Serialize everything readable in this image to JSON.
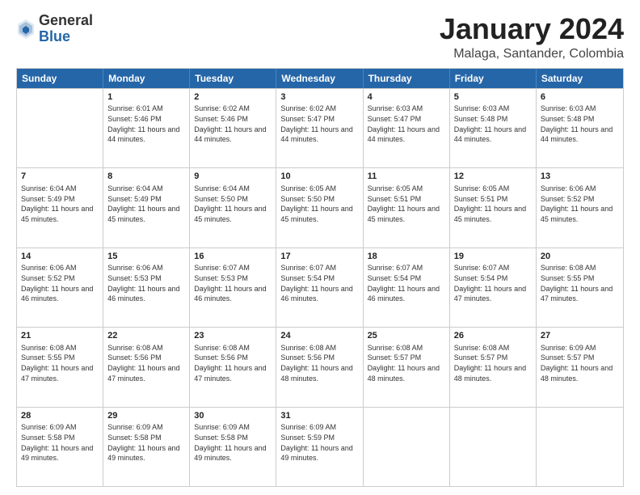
{
  "header": {
    "logo": {
      "general": "General",
      "blue": "Blue"
    },
    "title": "January 2024",
    "subtitle": "Malaga, Santander, Colombia"
  },
  "calendar": {
    "days_of_week": [
      "Sunday",
      "Monday",
      "Tuesday",
      "Wednesday",
      "Thursday",
      "Friday",
      "Saturday"
    ],
    "rows": [
      [
        {
          "day": "",
          "sunrise": "",
          "sunset": "",
          "daylight": ""
        },
        {
          "day": "1",
          "sunrise": "Sunrise: 6:01 AM",
          "sunset": "Sunset: 5:46 PM",
          "daylight": "Daylight: 11 hours and 44 minutes."
        },
        {
          "day": "2",
          "sunrise": "Sunrise: 6:02 AM",
          "sunset": "Sunset: 5:46 PM",
          "daylight": "Daylight: 11 hours and 44 minutes."
        },
        {
          "day": "3",
          "sunrise": "Sunrise: 6:02 AM",
          "sunset": "Sunset: 5:47 PM",
          "daylight": "Daylight: 11 hours and 44 minutes."
        },
        {
          "day": "4",
          "sunrise": "Sunrise: 6:03 AM",
          "sunset": "Sunset: 5:47 PM",
          "daylight": "Daylight: 11 hours and 44 minutes."
        },
        {
          "day": "5",
          "sunrise": "Sunrise: 6:03 AM",
          "sunset": "Sunset: 5:48 PM",
          "daylight": "Daylight: 11 hours and 44 minutes."
        },
        {
          "day": "6",
          "sunrise": "Sunrise: 6:03 AM",
          "sunset": "Sunset: 5:48 PM",
          "daylight": "Daylight: 11 hours and 44 minutes."
        }
      ],
      [
        {
          "day": "7",
          "sunrise": "Sunrise: 6:04 AM",
          "sunset": "Sunset: 5:49 PM",
          "daylight": "Daylight: 11 hours and 45 minutes."
        },
        {
          "day": "8",
          "sunrise": "Sunrise: 6:04 AM",
          "sunset": "Sunset: 5:49 PM",
          "daylight": "Daylight: 11 hours and 45 minutes."
        },
        {
          "day": "9",
          "sunrise": "Sunrise: 6:04 AM",
          "sunset": "Sunset: 5:50 PM",
          "daylight": "Daylight: 11 hours and 45 minutes."
        },
        {
          "day": "10",
          "sunrise": "Sunrise: 6:05 AM",
          "sunset": "Sunset: 5:50 PM",
          "daylight": "Daylight: 11 hours and 45 minutes."
        },
        {
          "day": "11",
          "sunrise": "Sunrise: 6:05 AM",
          "sunset": "Sunset: 5:51 PM",
          "daylight": "Daylight: 11 hours and 45 minutes."
        },
        {
          "day": "12",
          "sunrise": "Sunrise: 6:05 AM",
          "sunset": "Sunset: 5:51 PM",
          "daylight": "Daylight: 11 hours and 45 minutes."
        },
        {
          "day": "13",
          "sunrise": "Sunrise: 6:06 AM",
          "sunset": "Sunset: 5:52 PM",
          "daylight": "Daylight: 11 hours and 45 minutes."
        }
      ],
      [
        {
          "day": "14",
          "sunrise": "Sunrise: 6:06 AM",
          "sunset": "Sunset: 5:52 PM",
          "daylight": "Daylight: 11 hours and 46 minutes."
        },
        {
          "day": "15",
          "sunrise": "Sunrise: 6:06 AM",
          "sunset": "Sunset: 5:53 PM",
          "daylight": "Daylight: 11 hours and 46 minutes."
        },
        {
          "day": "16",
          "sunrise": "Sunrise: 6:07 AM",
          "sunset": "Sunset: 5:53 PM",
          "daylight": "Daylight: 11 hours and 46 minutes."
        },
        {
          "day": "17",
          "sunrise": "Sunrise: 6:07 AM",
          "sunset": "Sunset: 5:54 PM",
          "daylight": "Daylight: 11 hours and 46 minutes."
        },
        {
          "day": "18",
          "sunrise": "Sunrise: 6:07 AM",
          "sunset": "Sunset: 5:54 PM",
          "daylight": "Daylight: 11 hours and 46 minutes."
        },
        {
          "day": "19",
          "sunrise": "Sunrise: 6:07 AM",
          "sunset": "Sunset: 5:54 PM",
          "daylight": "Daylight: 11 hours and 47 minutes."
        },
        {
          "day": "20",
          "sunrise": "Sunrise: 6:08 AM",
          "sunset": "Sunset: 5:55 PM",
          "daylight": "Daylight: 11 hours and 47 minutes."
        }
      ],
      [
        {
          "day": "21",
          "sunrise": "Sunrise: 6:08 AM",
          "sunset": "Sunset: 5:55 PM",
          "daylight": "Daylight: 11 hours and 47 minutes."
        },
        {
          "day": "22",
          "sunrise": "Sunrise: 6:08 AM",
          "sunset": "Sunset: 5:56 PM",
          "daylight": "Daylight: 11 hours and 47 minutes."
        },
        {
          "day": "23",
          "sunrise": "Sunrise: 6:08 AM",
          "sunset": "Sunset: 5:56 PM",
          "daylight": "Daylight: 11 hours and 47 minutes."
        },
        {
          "day": "24",
          "sunrise": "Sunrise: 6:08 AM",
          "sunset": "Sunset: 5:56 PM",
          "daylight": "Daylight: 11 hours and 48 minutes."
        },
        {
          "day": "25",
          "sunrise": "Sunrise: 6:08 AM",
          "sunset": "Sunset: 5:57 PM",
          "daylight": "Daylight: 11 hours and 48 minutes."
        },
        {
          "day": "26",
          "sunrise": "Sunrise: 6:08 AM",
          "sunset": "Sunset: 5:57 PM",
          "daylight": "Daylight: 11 hours and 48 minutes."
        },
        {
          "day": "27",
          "sunrise": "Sunrise: 6:09 AM",
          "sunset": "Sunset: 5:57 PM",
          "daylight": "Daylight: 11 hours and 48 minutes."
        }
      ],
      [
        {
          "day": "28",
          "sunrise": "Sunrise: 6:09 AM",
          "sunset": "Sunset: 5:58 PM",
          "daylight": "Daylight: 11 hours and 49 minutes."
        },
        {
          "day": "29",
          "sunrise": "Sunrise: 6:09 AM",
          "sunset": "Sunset: 5:58 PM",
          "daylight": "Daylight: 11 hours and 49 minutes."
        },
        {
          "day": "30",
          "sunrise": "Sunrise: 6:09 AM",
          "sunset": "Sunset: 5:58 PM",
          "daylight": "Daylight: 11 hours and 49 minutes."
        },
        {
          "day": "31",
          "sunrise": "Sunrise: 6:09 AM",
          "sunset": "Sunset: 5:59 PM",
          "daylight": "Daylight: 11 hours and 49 minutes."
        },
        {
          "day": "",
          "sunrise": "",
          "sunset": "",
          "daylight": ""
        },
        {
          "day": "",
          "sunrise": "",
          "sunset": "",
          "daylight": ""
        },
        {
          "day": "",
          "sunrise": "",
          "sunset": "",
          "daylight": ""
        }
      ]
    ]
  }
}
